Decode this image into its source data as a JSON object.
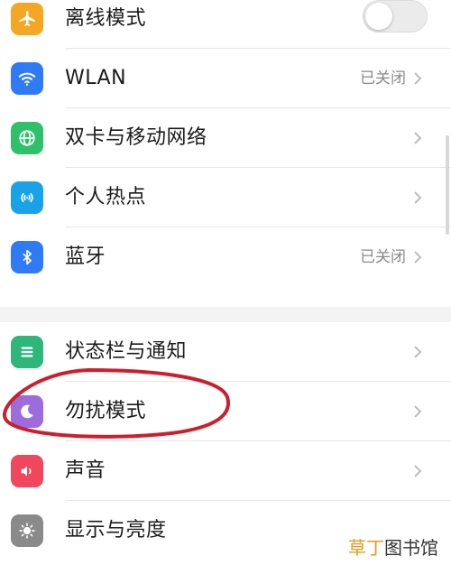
{
  "settings": {
    "group1": [
      {
        "label": "离线模式",
        "icon": "airplane-icon",
        "color": "#f5a623",
        "control": "toggle",
        "toggle_on": false
      },
      {
        "label": "WLAN",
        "icon": "wifi-icon",
        "color": "#2f7bf6",
        "control": "status",
        "status": "已关闭"
      },
      {
        "label": "双卡与移动网络",
        "icon": "globe-icon",
        "color": "#2fc06a",
        "control": "chevron"
      },
      {
        "label": "个人热点",
        "icon": "hotspot-icon",
        "color": "#1aa2e8",
        "control": "chevron"
      },
      {
        "label": "蓝牙",
        "icon": "bluetooth-icon",
        "color": "#2f7bf6",
        "control": "status",
        "status": "已关闭"
      }
    ],
    "group2": [
      {
        "label": "状态栏与通知",
        "icon": "notification-bar-icon",
        "color": "#2fb67a",
        "control": "chevron"
      },
      {
        "label": "勿扰模式",
        "icon": "moon-icon",
        "color": "#9c6bdc",
        "control": "chevron"
      },
      {
        "label": "声音",
        "icon": "speaker-icon",
        "color": "#f0465e",
        "control": "chevron"
      },
      {
        "label": "显示与亮度",
        "icon": "brightness-icon",
        "color": "#8a8a8a",
        "control": "chevron"
      }
    ]
  },
  "annotation": {
    "color": "#cc1f2e",
    "target": "勿扰模式"
  },
  "watermark": {
    "brand": "草丁",
    "suffix": "图书馆"
  }
}
